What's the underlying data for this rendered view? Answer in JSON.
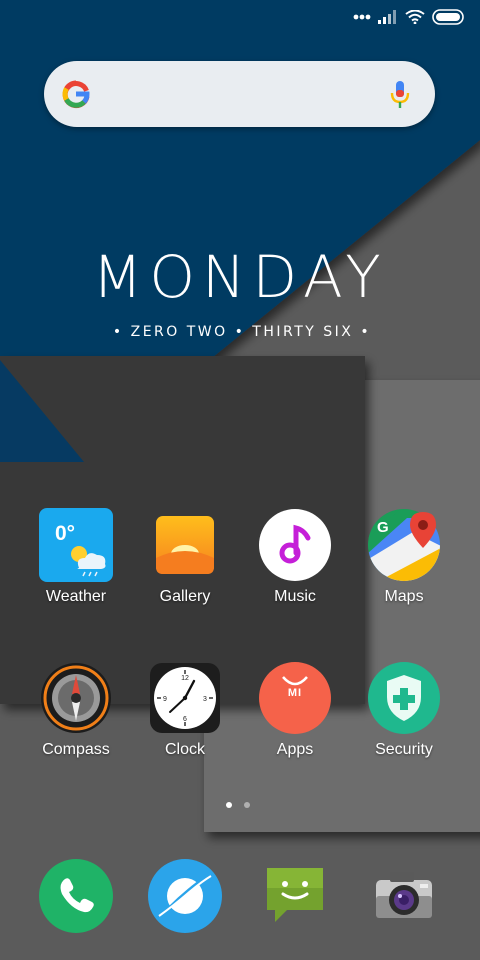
{
  "status_bar": {
    "icons": [
      "signal-dots-icon",
      "cellular-signal-icon",
      "wifi-icon",
      "battery-icon"
    ]
  },
  "search_bar": {
    "icons": [
      "google-logo-icon",
      "microphone-icon"
    ]
  },
  "clock_widget": {
    "day": "MONDAY",
    "time_text": "• ZERO TWO • THIRTY SIX •"
  },
  "apps": [
    {
      "label": "Weather",
      "temp": "0°",
      "icon": "weather-icon"
    },
    {
      "label": "Gallery",
      "icon": "gallery-icon"
    },
    {
      "label": "Music",
      "icon": "music-icon"
    },
    {
      "label": "Maps",
      "icon": "maps-icon"
    },
    {
      "label": "Compass",
      "icon": "compass-icon"
    },
    {
      "label": "Clock",
      "icon": "clock-icon"
    },
    {
      "label": "Apps",
      "icon": "mi-apps-icon",
      "logo_text": "MI"
    },
    {
      "label": "Security",
      "icon": "security-shield-icon"
    }
  ],
  "page_indicator": {
    "pages": 2,
    "current": 1
  },
  "dock": [
    {
      "name": "phone",
      "icon": "phone-icon",
      "color": "#1fb367"
    },
    {
      "name": "browser",
      "icon": "browser-icon",
      "color": "#2ba4ea"
    },
    {
      "name": "messaging",
      "icon": "messaging-icon",
      "color": "#74a22e"
    },
    {
      "name": "camera",
      "icon": "camera-icon",
      "color": "#3a3a3a"
    }
  ],
  "colors": {
    "wallpaper_blue": "#063a62",
    "panel_dark": "#383838",
    "panel_gray": "#6d6d6d",
    "background": "#2b2b2b"
  }
}
